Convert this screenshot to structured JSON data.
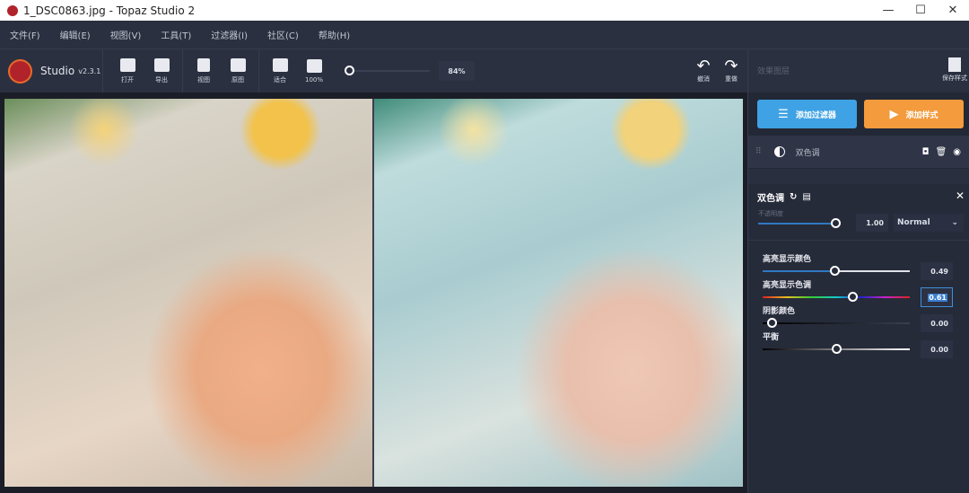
{
  "window": {
    "title": "1_DSC0863.jpg - Topaz Studio 2",
    "minimize": "—",
    "maximize": "☐",
    "close": "✕"
  },
  "menu": [
    "文件(F)",
    "编辑(E)",
    "视图(V)",
    "工具(T)",
    "过滤器(I)",
    "社区(C)",
    "帮助(H)"
  ],
  "brand": {
    "name": "Studio",
    "version": "v2.3.1"
  },
  "toolbar": {
    "open": "打开",
    "export": "导出",
    "view": "视图",
    "original": "原图",
    "fit": "适合",
    "full": "100%",
    "zoom": "84%",
    "zoom_percent": 84,
    "undo": "撤消",
    "redo": "重做"
  },
  "panel": {
    "title": "效果图层",
    "save_style": "保存样式",
    "add_filter": "添加过滤器",
    "add_style": "添加样式",
    "layer": {
      "name": "双色调"
    },
    "filter": {
      "title": "双色调",
      "opacity_label": "不透明度",
      "opacity": "1.00",
      "blend_mode": "Normal",
      "params": [
        {
          "label": "高亮显示颜色",
          "value": "0.49"
        },
        {
          "label": "高亮显示色调",
          "value": "0.61"
        },
        {
          "label": "阴影颜色",
          "value": "0.00"
        },
        {
          "label": "平衡",
          "value": "0.00"
        }
      ]
    }
  },
  "colors": {
    "accent_blue": "#3fa2e4",
    "accent_orange": "#f39b3d",
    "bg": "#2b3040"
  }
}
